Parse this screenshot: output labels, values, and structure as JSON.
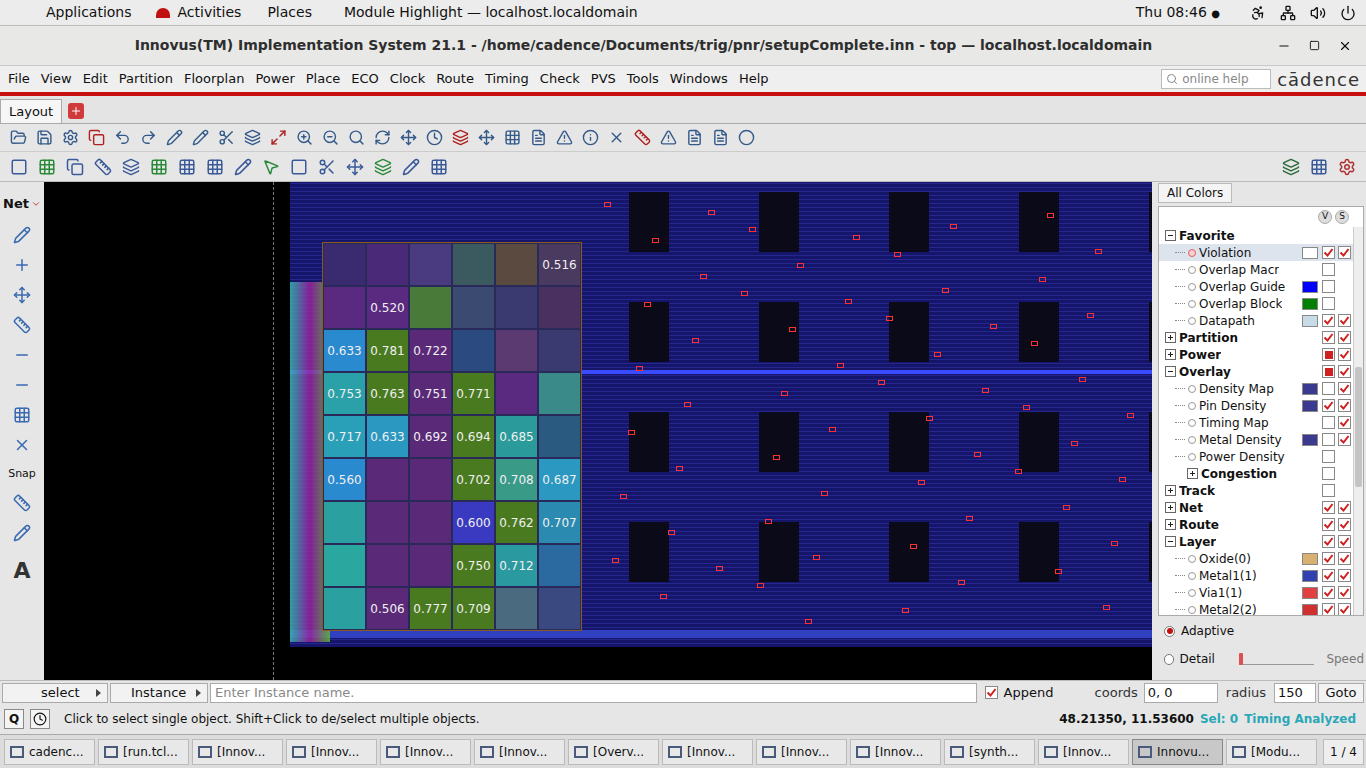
{
  "topbar": {
    "items": [
      "Applications",
      "Activities",
      "Places"
    ],
    "app": "Module Highlight — localhost.localdomain",
    "clock": "Thu 08:46",
    "clock_dot": "●"
  },
  "window": {
    "title": "Innovus(TM) Implementation System 21.1 - /home/cadence/Documents/trig/pnr/setupComplete.inn - top — localhost.localdomain"
  },
  "menu": [
    "File",
    "View",
    "Edit",
    "Partition",
    "Floorplan",
    "Power",
    "Place",
    "ECO",
    "Clock",
    "Route",
    "Timing",
    "Check",
    "PVS",
    "Tools",
    "Windows",
    "Help"
  ],
  "search": {
    "placeholder": "online help"
  },
  "logo": "cādence",
  "tabs": [
    {
      "label": "Layout",
      "selected": true
    }
  ],
  "palette": {
    "net_label": "Net",
    "snap_label": "Snap",
    "text_tool": "A"
  },
  "density_map": {
    "rows": [
      [
        {
          "value": null,
          "color": "#3a2a70"
        },
        {
          "value": null,
          "color": "#4a2a78"
        },
        {
          "value": null,
          "color": "#4a3a80"
        },
        {
          "value": null,
          "color": "#3a5a60"
        },
        {
          "value": null,
          "color": "#5a4a40"
        },
        {
          "value": "0.516",
          "color": "#4a3a60"
        }
      ],
      [
        {
          "value": null,
          "color": "#5a2a80"
        },
        {
          "value": "0.520",
          "color": "#5a2a80"
        },
        {
          "value": null,
          "color": "#4a7a3a"
        },
        {
          "value": null,
          "color": "#3a4a70"
        },
        {
          "value": null,
          "color": "#3a3a70"
        },
        {
          "value": null,
          "color": "#4a3060"
        }
      ],
      [
        {
          "value": "0.633",
          "color": "#2a8ad0"
        },
        {
          "value": "0.781",
          "color": "#4a7a20"
        },
        {
          "value": "0.722",
          "color": "#5a2a78"
        },
        {
          "value": null,
          "color": "#2a4a80"
        },
        {
          "value": null,
          "color": "#5a3a70"
        },
        {
          "value": null,
          "color": "#3a3a70"
        }
      ],
      [
        {
          "value": "0.753",
          "color": "#2aa0a8"
        },
        {
          "value": "0.763",
          "color": "#4a7a20"
        },
        {
          "value": "0.751",
          "color": "#5a2a78"
        },
        {
          "value": "0.771",
          "color": "#4a7a20"
        },
        {
          "value": null,
          "color": "#5a2a80"
        },
        {
          "value": null,
          "color": "#3a8a8a"
        }
      ],
      [
        {
          "value": "0.717",
          "color": "#2aa0b8"
        },
        {
          "value": "0.633",
          "color": "#2a98c0"
        },
        {
          "value": "0.692",
          "color": "#5a2a78"
        },
        {
          "value": "0.694",
          "color": "#4a7a20"
        },
        {
          "value": "0.685",
          "color": "#2a9a9a"
        },
        {
          "value": null,
          "color": "#2a5a80"
        }
      ],
      [
        {
          "value": "0.560",
          "color": "#2a8ad0"
        },
        {
          "value": null,
          "color": "#5a2a78"
        },
        {
          "value": null,
          "color": "#5a2a78"
        },
        {
          "value": "0.702",
          "color": "#4a7a20"
        },
        {
          "value": "0.708",
          "color": "#3a9a88"
        },
        {
          "value": "0.687",
          "color": "#2a98c0"
        }
      ],
      [
        {
          "value": null,
          "color": "#2aa0a0"
        },
        {
          "value": null,
          "color": "#5a2a78"
        },
        {
          "value": null,
          "color": "#5a2a78"
        },
        {
          "value": "0.600",
          "color": "#3a3ac0"
        },
        {
          "value": "0.762",
          "color": "#4a7a20"
        },
        {
          "value": "0.707",
          "color": "#2a8ab0"
        }
      ],
      [
        {
          "value": null,
          "color": "#2aa8a0"
        },
        {
          "value": null,
          "color": "#5a2a78"
        },
        {
          "value": null,
          "color": "#5a2a78"
        },
        {
          "value": "0.750",
          "color": "#4a7a20"
        },
        {
          "value": "0.712",
          "color": "#2a9aa0"
        },
        {
          "value": null,
          "color": "#2a6aa0"
        }
      ],
      [
        {
          "value": null,
          "color": "#2aa0a0"
        },
        {
          "value": "0.506",
          "color": "#5a2a78"
        },
        {
          "value": "0.777",
          "color": "#4a7a20"
        },
        {
          "value": "0.709",
          "color": "#4a7a20"
        },
        {
          "value": null,
          "color": "#4a6a80"
        },
        {
          "value": null,
          "color": "#3a4a80"
        }
      ]
    ]
  },
  "panel": {
    "all_colors": "All Colors",
    "columns": [
      "V",
      "S"
    ],
    "tree": [
      {
        "label": "Favorite",
        "kind": "group",
        "depth": 0,
        "expanded": true,
        "selected": false,
        "swatch": null,
        "visible": null,
        "selectable": null,
        "mixed": false
      },
      {
        "label": "Violation",
        "kind": "item",
        "depth": 1,
        "expanded": false,
        "selected": true,
        "swatch": "#ffffff",
        "visible": true,
        "selectable": true,
        "mixed": false
      },
      {
        "label": "Overlap Macr",
        "kind": "item",
        "depth": 1,
        "expanded": false,
        "selected": false,
        "swatch": null,
        "visible": false,
        "selectable": null,
        "mixed": false
      },
      {
        "label": "Overlap Guide",
        "kind": "item",
        "depth": 1,
        "expanded": false,
        "selected": false,
        "swatch": "#0000ff",
        "visible": false,
        "selectable": null,
        "mixed": false
      },
      {
        "label": "Overlap Block",
        "kind": "item",
        "depth": 1,
        "expanded": false,
        "selected": false,
        "swatch": "#008000",
        "visible": false,
        "selectable": null,
        "mixed": false
      },
      {
        "label": "Datapath",
        "kind": "item",
        "depth": 1,
        "expanded": false,
        "selected": false,
        "swatch": "#c8dce8",
        "visible": true,
        "selectable": true,
        "mixed": false
      },
      {
        "label": "Partition",
        "kind": "group",
        "depth": 0,
        "expanded": false,
        "selected": false,
        "swatch": null,
        "visible": true,
        "selectable": true,
        "mixed": false
      },
      {
        "label": "Power",
        "kind": "group",
        "depth": 0,
        "expanded": false,
        "selected": false,
        "swatch": null,
        "visible": true,
        "selectable": true,
        "mixed": true
      },
      {
        "label": "Overlay",
        "kind": "group",
        "depth": 0,
        "expanded": true,
        "selected": false,
        "swatch": null,
        "visible": true,
        "selectable": true,
        "mixed": true
      },
      {
        "label": "Density Map",
        "kind": "item",
        "depth": 1,
        "expanded": false,
        "selected": false,
        "swatch": "#3a3a90",
        "visible": false,
        "selectable": true,
        "mixed": false
      },
      {
        "label": "Pin Density",
        "kind": "item",
        "depth": 1,
        "expanded": false,
        "selected": false,
        "swatch": "#3a3a90",
        "visible": true,
        "selectable": true,
        "mixed": false
      },
      {
        "label": "Timing Map",
        "kind": "item",
        "depth": 1,
        "expanded": false,
        "selected": false,
        "swatch": null,
        "visible": false,
        "selectable": true,
        "mixed": false
      },
      {
        "label": "Metal Density",
        "kind": "item",
        "depth": 1,
        "expanded": false,
        "selected": false,
        "swatch": "#3a3a90",
        "visible": false,
        "selectable": true,
        "mixed": false
      },
      {
        "label": "Power Density",
        "kind": "item",
        "depth": 1,
        "expanded": false,
        "selected": false,
        "swatch": null,
        "visible": false,
        "selectable": null,
        "mixed": false
      },
      {
        "label": "Congestion",
        "kind": "group",
        "depth": 1,
        "expanded": false,
        "selected": false,
        "swatch": null,
        "visible": false,
        "selectable": null,
        "mixed": false
      },
      {
        "label": "Track",
        "kind": "group",
        "depth": 0,
        "expanded": false,
        "selected": false,
        "swatch": null,
        "visible": false,
        "selectable": null,
        "mixed": false
      },
      {
        "label": "Net",
        "kind": "group",
        "depth": 0,
        "expanded": false,
        "selected": false,
        "swatch": null,
        "visible": true,
        "selectable": true,
        "mixed": false
      },
      {
        "label": "Route",
        "kind": "group",
        "depth": 0,
        "expanded": false,
        "selected": false,
        "swatch": null,
        "visible": true,
        "selectable": true,
        "mixed": false
      },
      {
        "label": "Layer",
        "kind": "group",
        "depth": 0,
        "expanded": true,
        "selected": false,
        "swatch": null,
        "visible": true,
        "selectable": true,
        "mixed": false
      },
      {
        "label": "Oxide(0)",
        "kind": "item",
        "depth": 1,
        "expanded": false,
        "selected": false,
        "swatch": "#d8b070",
        "visible": true,
        "selectable": true,
        "mixed": false
      },
      {
        "label": "Metal1(1)",
        "kind": "item",
        "depth": 1,
        "expanded": false,
        "selected": false,
        "swatch": "#3040b0",
        "visible": true,
        "selectable": true,
        "mixed": false
      },
      {
        "label": "Via1(1)",
        "kind": "item",
        "depth": 1,
        "expanded": false,
        "selected": false,
        "swatch": "#e04040",
        "visible": true,
        "selectable": true,
        "mixed": false
      },
      {
        "label": "Metal2(2)",
        "kind": "item",
        "depth": 1,
        "expanded": false,
        "selected": false,
        "swatch": "#d03030",
        "visible": true,
        "selectable": true,
        "mixed": false
      }
    ],
    "modes": [
      {
        "label": "Adaptive",
        "selected": true
      },
      {
        "label": "Detail",
        "selected": false
      }
    ],
    "speed_label": "Speed",
    "speed_level": 0.0
  },
  "find_bar": {
    "mode": "select",
    "type": "Instance",
    "placeholder": "Enter Instance name.",
    "append": {
      "label": "Append",
      "checked": true
    },
    "coords_label": "coords",
    "coords": "0, 0",
    "radius_label": "radius",
    "radius": "150",
    "goto": "Goto"
  },
  "status_bar": {
    "q": "Q",
    "message": "Click to select single object. Shift+Click to de/select multiple objects.",
    "cursor": "48.21350, 11.53600",
    "selection": "Sel: 0",
    "timing": "Timing Analyzed"
  },
  "taskbar": {
    "items": [
      {
        "label": "cadenc...",
        "selected": false
      },
      {
        "label": "[run.tcl...",
        "selected": false
      },
      {
        "label": "[Innov...",
        "selected": false
      },
      {
        "label": "[Innov...",
        "selected": false
      },
      {
        "label": "[Innov...",
        "selected": false
      },
      {
        "label": "[Innov...",
        "selected": false
      },
      {
        "label": "[Overv...",
        "selected": false
      },
      {
        "label": "[Innov...",
        "selected": false
      },
      {
        "label": "[Innov...",
        "selected": false
      },
      {
        "label": "[Innov...",
        "selected": false
      },
      {
        "label": "[synth...",
        "selected": false
      },
      {
        "label": "[Innov...",
        "selected": false
      },
      {
        "label": "Innovu...",
        "selected": true
      },
      {
        "label": "[Modu...",
        "selected": false
      }
    ],
    "pager": "1 / 4"
  }
}
